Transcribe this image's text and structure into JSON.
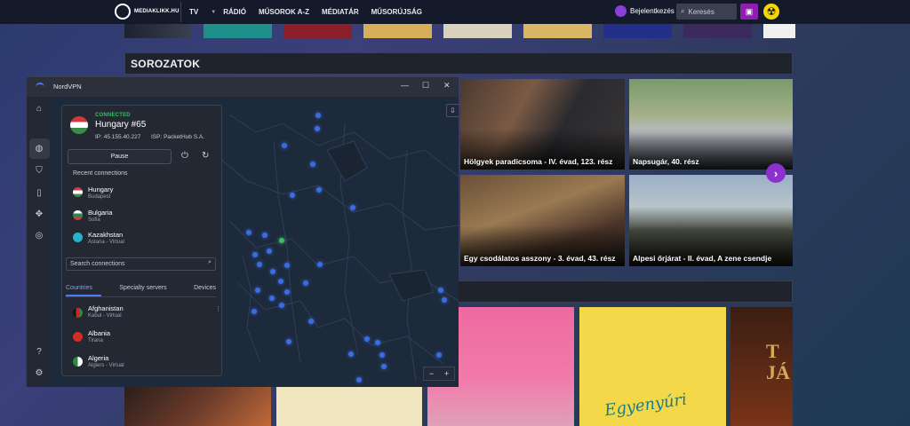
{
  "site": {
    "logo_text": "MEDIAKLIKK.HU",
    "nav": [
      {
        "label": "TV",
        "caret": true
      },
      {
        "label": "RÁDIÓ",
        "caret": true
      },
      {
        "label": "MŰSOROK A-Z",
        "caret": false
      },
      {
        "label": "MÉDIATÁR",
        "caret": false
      },
      {
        "label": "MŰSORÚJSÁG",
        "caret": false
      }
    ],
    "login_label": "Bejelentkezés",
    "search_placeholder": "Keresés",
    "section_title": "SOROZATOK",
    "cards": [
      {
        "title": "Hölgyek paradicsoma - IV. évad, 123. rész"
      },
      {
        "title": "Napsugár, 40. rész"
      },
      {
        "title": "Egy csodálatos asszony - 3. évad, 43. rész"
      },
      {
        "title": "Alpesi őrjárat - II. évad, A zene csendje"
      }
    ],
    "poster_text": "Egyenyúri",
    "poster_text_2": "T\nJÁ"
  },
  "vpn": {
    "app_name": "NordVPN",
    "status": "CONNECTED",
    "server": "Hungary #65",
    "ip": "IP: 45.155.40.227",
    "isp": "ISP: PacketHub S.A.",
    "pause_label": "Pause",
    "recent_header": "Recent connections",
    "recent": [
      {
        "name": "Hungary",
        "sub": "Budapest",
        "flag": "hu"
      },
      {
        "name": "Bulgaria",
        "sub": "Sofia",
        "flag": "bg"
      },
      {
        "name": "Kazakhstan",
        "sub": "Astana - Virtual",
        "flag": "kz"
      }
    ],
    "search_placeholder": "Search connections",
    "tabs": [
      "Countries",
      "Specialty servers",
      "Devices"
    ],
    "countries": [
      {
        "name": "Afghanistan",
        "sub": "Kabul - Virtual",
        "flag": "af"
      },
      {
        "name": "Albania",
        "sub": "Tirana",
        "flag": "al"
      },
      {
        "name": "Algeria",
        "sub": "Algiers - Virtual",
        "flag": "dz"
      }
    ],
    "colors": {
      "accent": "#4a7bff",
      "connected": "#3dbb6a",
      "server_dot": "#3a6de0"
    }
  }
}
